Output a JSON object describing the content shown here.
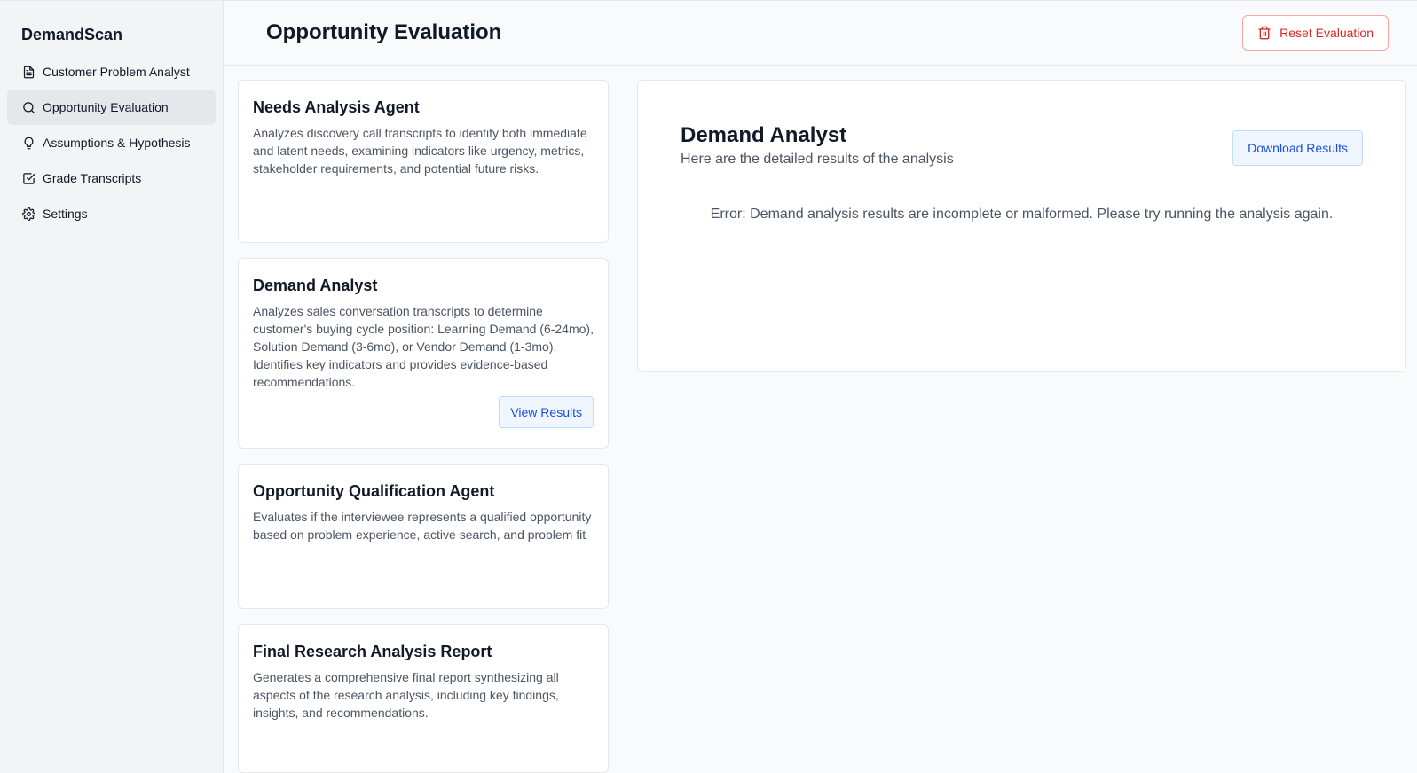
{
  "sidebar": {
    "brand": "DemandScan",
    "items": [
      {
        "label": "Customer Problem Analyst",
        "icon": "document-icon"
      },
      {
        "label": "Opportunity Evaluation",
        "icon": "search-icon"
      },
      {
        "label": "Assumptions & Hypothesis",
        "icon": "lightbulb-icon"
      },
      {
        "label": "Grade Transcripts",
        "icon": "checkbox-icon"
      },
      {
        "label": "Settings",
        "icon": "gear-icon"
      }
    ],
    "active_index": 1
  },
  "header": {
    "title": "Opportunity Evaluation",
    "reset_label": "Reset Evaluation"
  },
  "agents": [
    {
      "title": "Needs Analysis Agent",
      "description": "Analyzes discovery call transcripts to identify both immediate and latent needs, examining indicators like urgency, metrics, stakeholder requirements, and potential future risks."
    },
    {
      "title": "Demand Analyst",
      "description": "Analyzes sales conversation transcripts to determine customer's buying cycle position: Learning Demand (6-24mo), Solution Demand (3-6mo), or Vendor Demand (1-3mo). Identifies key indicators and provides evidence-based recommendations.",
      "action_label": "View Results"
    },
    {
      "title": "Opportunity Qualification Agent",
      "description": "Evaluates if the interviewee represents a qualified opportunity based on problem experience, active search, and problem fit"
    },
    {
      "title": "Final Research Analysis Report",
      "description": "Generates a comprehensive final report synthesizing all aspects of the research analysis, including key findings, insights, and recommendations."
    }
  ],
  "results": {
    "title": "Demand Analyst",
    "subtitle": "Here are the detailed results of the analysis",
    "download_label": "Download Results",
    "error": "Error: Demand analysis results are incomplete or malformed. Please try running the analysis again."
  },
  "colors": {
    "danger": "#dc2626",
    "primary": "#1d4ed8",
    "primary_bg": "#eff6ff"
  }
}
